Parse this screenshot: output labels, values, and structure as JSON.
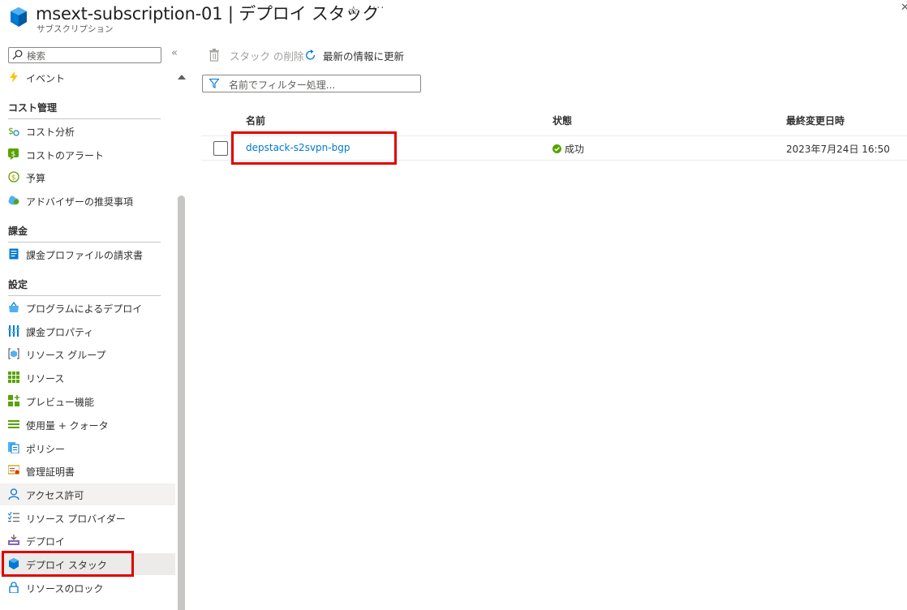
{
  "header": {
    "title": "msext-subscription-01 | デプロイ スタック",
    "subtitle": "サブスクリプション",
    "favorite_icon": "star-icon",
    "more_label": "···",
    "close_label": "✕"
  },
  "sidebar": {
    "search_placeholder": "検索",
    "collapse_label": "«",
    "items_top": [
      {
        "label": "イベント",
        "icon": "lightning-icon"
      }
    ],
    "sections": [
      {
        "title": "コスト管理",
        "items": [
          {
            "label": "コスト分析",
            "icon": "cost-analysis-icon"
          },
          {
            "label": "コストのアラート",
            "icon": "cost-alert-icon"
          },
          {
            "label": "予算",
            "icon": "budget-icon"
          },
          {
            "label": "アドバイザーの推奨事項",
            "icon": "advisor-icon"
          }
        ]
      },
      {
        "title": "課金",
        "items": [
          {
            "label": "課金プロファイルの請求書",
            "icon": "invoice-icon"
          }
        ]
      },
      {
        "title": "設定",
        "items": [
          {
            "label": "プログラムによるデプロイ",
            "icon": "programmatic-deploy-icon"
          },
          {
            "label": "課金プロパティ",
            "icon": "billing-properties-icon"
          },
          {
            "label": "リソース グループ",
            "icon": "resource-group-icon"
          },
          {
            "label": "リソース",
            "icon": "resources-icon"
          },
          {
            "label": "プレビュー機能",
            "icon": "preview-features-icon"
          },
          {
            "label": "使用量 + クォータ",
            "icon": "usage-quota-icon"
          },
          {
            "label": "ポリシー",
            "icon": "policy-icon"
          },
          {
            "label": "管理証明書",
            "icon": "certificate-icon"
          },
          {
            "label": "アクセス許可",
            "icon": "person-icon"
          },
          {
            "label": "リソース プロバイダー",
            "icon": "resource-provider-icon"
          },
          {
            "label": "デプロイ",
            "icon": "deploy-icon"
          },
          {
            "label": "デプロイ スタック",
            "icon": "deployment-stack-icon"
          },
          {
            "label": "リソースのロック",
            "icon": "lock-icon"
          }
        ]
      }
    ]
  },
  "toolbar": {
    "delete_label": "スタック の削除",
    "refresh_label": "最新の情報に更新"
  },
  "filter": {
    "placeholder": "名前でフィルター処理..."
  },
  "grid": {
    "columns": [
      "名前",
      "状態",
      "最終変更日時"
    ],
    "rows": [
      {
        "name": "depstack-s2svpn-bgp",
        "status": "成功",
        "modified": "2023年7月24日 16:50"
      }
    ]
  },
  "colors": {
    "accent": "#0078d4",
    "success": "#57a300",
    "highlight_box": "#e00000"
  }
}
